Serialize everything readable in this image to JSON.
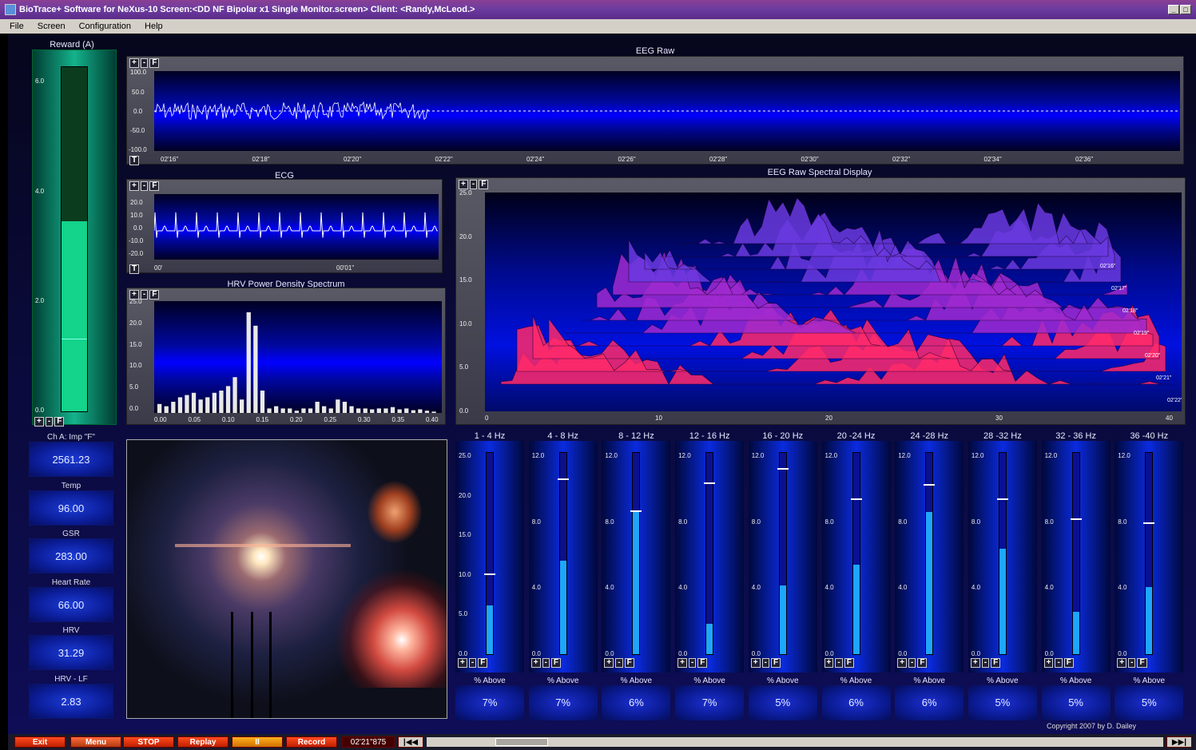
{
  "window": {
    "title": "BioTrace+ Software for NeXus-10    Screen:<DD NF Bipolar x1 Single Monitor.screen>  Client: <Randy,McLeod.>",
    "min_label": "_",
    "max_label": "□"
  },
  "menu": [
    "File",
    "Screen",
    "Configuration",
    "Help"
  ],
  "reward": {
    "title": "Reward (A)",
    "ticks": [
      "6.0",
      "4.0",
      "2.0",
      "0.0"
    ],
    "level": 0.55
  },
  "panel_controls": {
    "plus": "+",
    "minus": "-",
    "f": "F",
    "t": "T"
  },
  "eeg_raw": {
    "title": "EEG Raw",
    "yticks": [
      "100.0",
      "50.0",
      "0.0",
      "-50.0",
      "-100.0"
    ],
    "xticks": [
      "02'16\"",
      "02'18\"",
      "02'20\"",
      "02'22\"",
      "02'24\"",
      "02'26\"",
      "02'28\"",
      "02'30\"",
      "02'32\"",
      "02'34\"",
      "02'36\""
    ]
  },
  "ecg": {
    "title": "ECG",
    "yticks": [
      "20.0",
      "10.0",
      "0.0",
      "-10.0",
      "-20.0"
    ],
    "xticks": [
      "00'",
      "00'01\""
    ]
  },
  "hrv_psd": {
    "title": "HRV Power Density Spectrum",
    "yticks": [
      "25.0",
      "20.0",
      "15.0",
      "10.0",
      "5.0",
      "0.0"
    ],
    "xticks": [
      "0.00",
      "0.05",
      "0.10",
      "0.15",
      "0.20",
      "0.25",
      "0.30",
      "0.35",
      "0.40"
    ],
    "bars": [
      2,
      1.5,
      2.5,
      3.5,
      4,
      4.5,
      3,
      3.5,
      4.5,
      5,
      6,
      8,
      3,
      22.5,
      19.5,
      5,
      1,
      1.5,
      1,
      1,
      0.5,
      1,
      1,
      2.5,
      1.5,
      1,
      3,
      2.5,
      1.5,
      1,
      1,
      0.8,
      1,
      1,
      1.3,
      0.8,
      1,
      0.6,
      0.8,
      0.5,
      0.3
    ]
  },
  "spectral": {
    "title": "EEG Raw Spectral Display",
    "yticks": [
      "25.0",
      "20.0",
      "15.0",
      "10.0",
      "5.0",
      "0.0"
    ],
    "xticks": [
      "0",
      "10",
      "20",
      "30",
      "40"
    ],
    "time_labels": [
      "02'16\"",
      "02'17\"",
      "02'18\"",
      "02'19\"",
      "02'20\"",
      "02'21\"",
      "02'22\""
    ]
  },
  "meters": [
    {
      "label": "Ch A: Imp \"F\"",
      "value": "2561.23"
    },
    {
      "label": "Temp",
      "value": "96.00"
    },
    {
      "label": "GSR",
      "value": "283.00"
    },
    {
      "label": "Heart Rate",
      "value": "66.00"
    },
    {
      "label": "HRV",
      "value": "31.29"
    },
    {
      "label": "HRV - LF",
      "value": "2.83"
    }
  ],
  "bands": [
    {
      "label": "1 - 4 Hz",
      "ticks": [
        "25.0",
        "20.0",
        "15.0",
        "10.0",
        "5.0",
        "0.0"
      ],
      "level": 0.24,
      "threshold": 0.39,
      "pct_label": "% Above",
      "pct": "7%"
    },
    {
      "label": "4 - 8 Hz",
      "ticks": [
        "12.0",
        "8.0",
        "4.0",
        "0.0"
      ],
      "level": 0.46,
      "threshold": 0.86,
      "pct_label": "% Above",
      "pct": "7%"
    },
    {
      "label": "8 - 12 Hz",
      "ticks": [
        "12.0",
        "8.0",
        "4.0",
        "0.0"
      ],
      "level": 0.7,
      "threshold": 0.7,
      "pct_label": "% Above",
      "pct": "6%"
    },
    {
      "label": "12 - 16 Hz",
      "ticks": [
        "12.0",
        "8.0",
        "4.0",
        "0.0"
      ],
      "level": 0.15,
      "threshold": 0.84,
      "pct_label": "% Above",
      "pct": "7%"
    },
    {
      "label": "16 - 20 Hz",
      "ticks": [
        "12.0",
        "8.0",
        "4.0",
        "0.0"
      ],
      "level": 0.34,
      "threshold": 0.91,
      "pct_label": "% Above",
      "pct": "5%"
    },
    {
      "label": "20 -24 Hz",
      "ticks": [
        "12.0",
        "8.0",
        "4.0",
        "0.0"
      ],
      "level": 0.44,
      "threshold": 0.76,
      "pct_label": "% Above",
      "pct": "6%"
    },
    {
      "label": "24 -28 Hz",
      "ticks": [
        "12.0",
        "8.0",
        "4.0",
        "0.0"
      ],
      "level": 0.7,
      "threshold": 0.83,
      "pct_label": "% Above",
      "pct": "6%"
    },
    {
      "label": "28 -32 Hz",
      "ticks": [
        "12.0",
        "8.0",
        "4.0",
        "0.0"
      ],
      "level": 0.52,
      "threshold": 0.76,
      "pct_label": "% Above",
      "pct": "5%"
    },
    {
      "label": "32 - 36 Hz",
      "ticks": [
        "12.0",
        "8.0",
        "4.0",
        "0.0"
      ],
      "level": 0.21,
      "threshold": 0.66,
      "pct_label": "% Above",
      "pct": "5%"
    },
    {
      "label": "36 -40 Hz",
      "ticks": [
        "12.0",
        "8.0",
        "4.0",
        "0.0"
      ],
      "level": 0.33,
      "threshold": 0.64,
      "pct_label": "% Above",
      "pct": "5%"
    }
  ],
  "copyright": "Copyright 2007 by D. Dailey",
  "bottom": {
    "exit": "Exit",
    "menu": "Menu",
    "stop": "STOP",
    "replay": "Replay",
    "pause": "II",
    "record": "Record",
    "time": "02'21\"875",
    "rewind": "|◀◀",
    "forward": "▶▶|"
  }
}
